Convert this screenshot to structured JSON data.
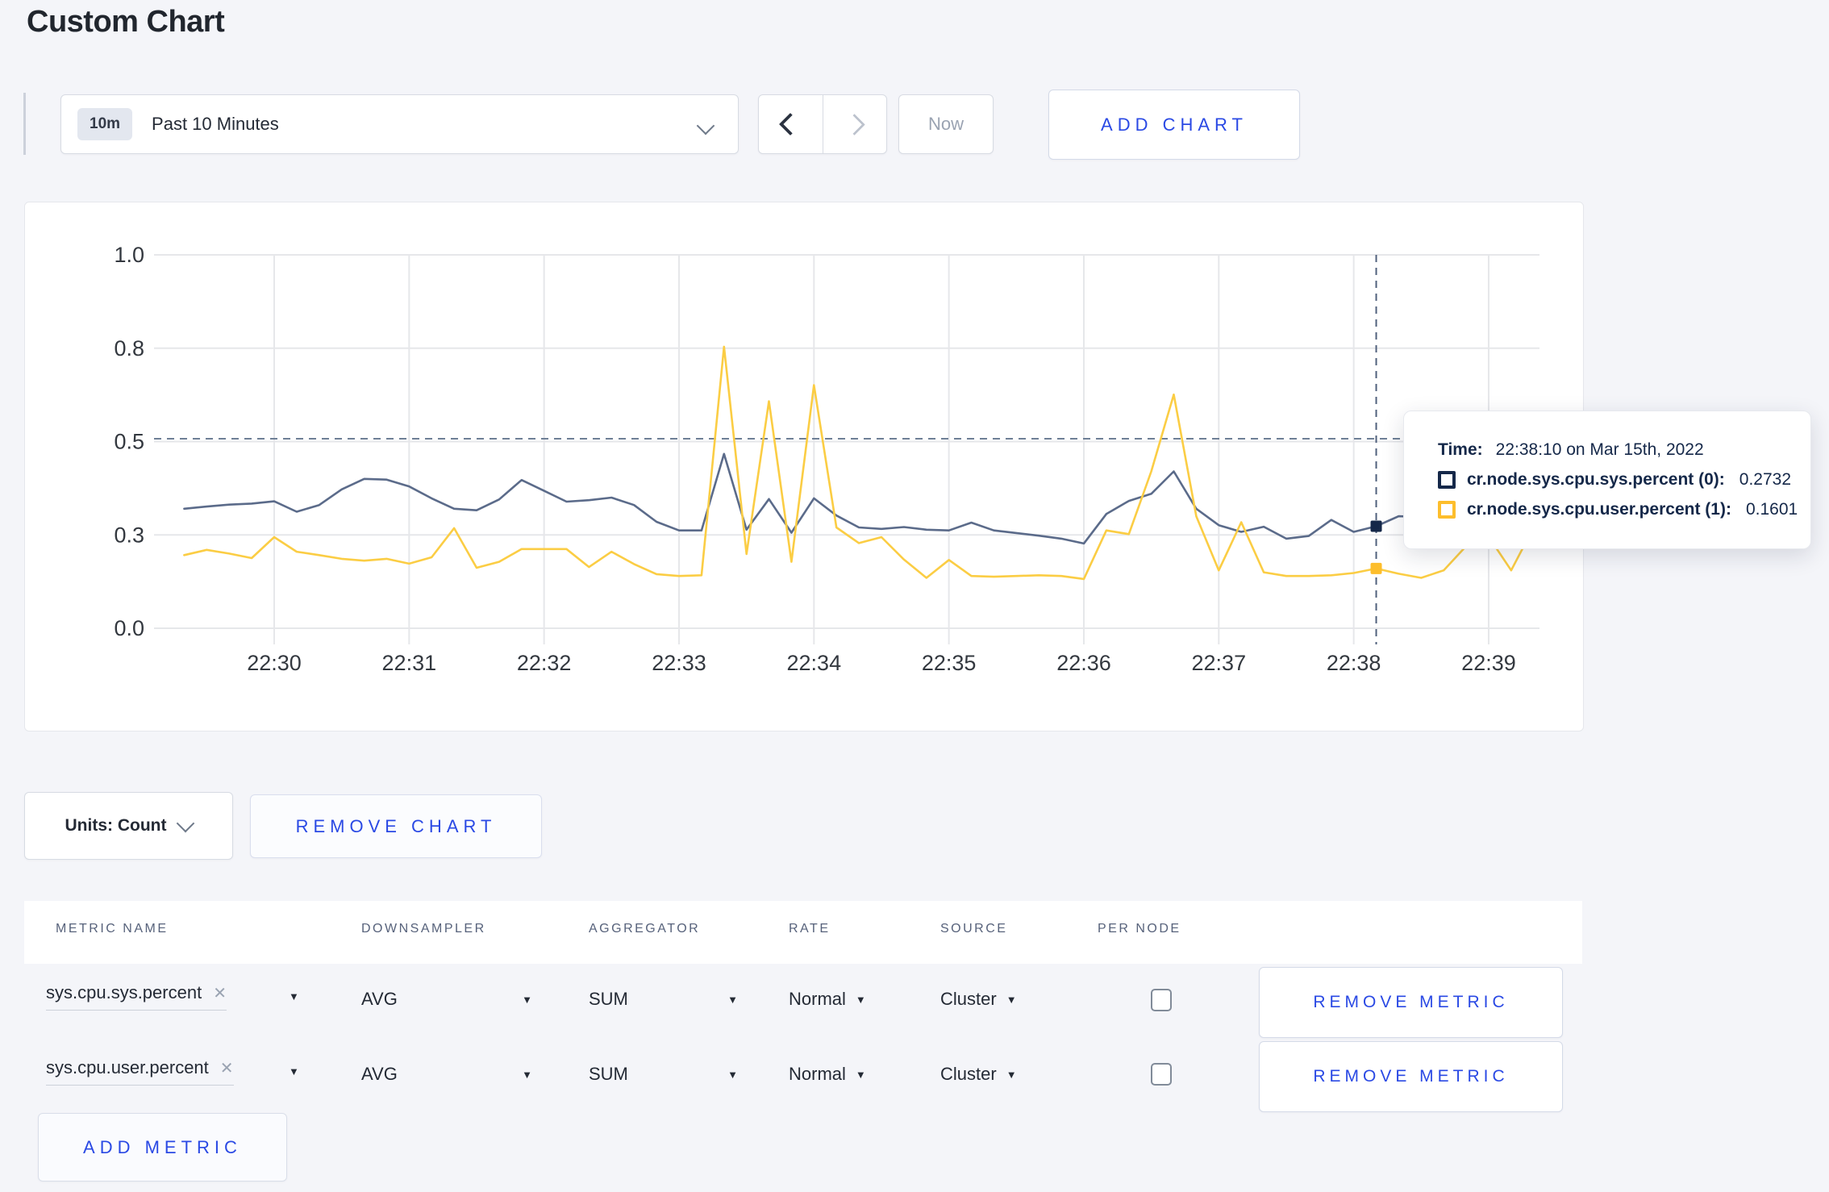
{
  "page": {
    "title": "Custom Chart"
  },
  "toolbar": {
    "time_badge": "10m",
    "time_label": "Past 10 Minutes",
    "now_label": "Now",
    "add_chart_label": "ADD CHART"
  },
  "chart_controls": {
    "units_label": "Units: Count",
    "remove_chart_label": "REMOVE CHART"
  },
  "tooltip": {
    "time_label": "Time:",
    "time_value": "22:38:10 on Mar 15th, 2022",
    "rows": [
      {
        "name": "cr.node.sys.cpu.sys.percent (0):",
        "value": "0.2732",
        "color": "#152849"
      },
      {
        "name": "cr.node.sys.cpu.user.percent (1):",
        "value": "0.1601",
        "color": "#fdbe2c"
      }
    ]
  },
  "chart_data": {
    "type": "line",
    "title": "",
    "xlabel": "",
    "ylabel": "",
    "grid": true,
    "legend_position": "tooltip-only",
    "ylim": [
      0,
      1
    ],
    "x_ticks": [
      "22:30",
      "22:31",
      "22:32",
      "22:33",
      "22:34",
      "22:35",
      "22:36",
      "22:37",
      "22:38",
      "22:39"
    ],
    "y_ticks": [
      {
        "value": 0,
        "label": "0.0"
      },
      {
        "value": 0.25,
        "label": "0.3"
      },
      {
        "value": 0.5,
        "label": "0.5"
      },
      {
        "value": 0.75,
        "label": "0.8"
      },
      {
        "value": 1,
        "label": "1.0"
      }
    ],
    "sample_interval_seconds": 10,
    "series": [
      {
        "name": "cr.node.sys.cpu.sys.percent (0)",
        "color": "#5b6b8a",
        "start_time": "22:29:20",
        "values": [
          0.32,
          0.326,
          0.331,
          0.334,
          0.34,
          0.312,
          0.33,
          0.372,
          0.4,
          0.398,
          0.38,
          0.348,
          0.32,
          0.316,
          0.345,
          0.397,
          0.368,
          0.339,
          0.343,
          0.35,
          0.33,
          0.285,
          0.262,
          0.262,
          0.467,
          0.264,
          0.346,
          0.256,
          0.348,
          0.302,
          0.27,
          0.266,
          0.271,
          0.264,
          0.262,
          0.283,
          0.262,
          0.255,
          0.248,
          0.24,
          0.227,
          0.306,
          0.341,
          0.36,
          0.42,
          0.32,
          0.276,
          0.258,
          0.272,
          0.24,
          0.247,
          0.29,
          0.258,
          0.2732,
          0.3,
          0.298,
          0.302,
          0.295,
          0.3,
          0.298,
          0.3
        ]
      },
      {
        "name": "cr.node.sys.cpu.user.percent (1)",
        "color": "#fbcd44",
        "start_time": "22:29:20",
        "values": [
          0.196,
          0.21,
          0.2,
          0.188,
          0.244,
          0.205,
          0.196,
          0.186,
          0.181,
          0.186,
          0.173,
          0.19,
          0.268,
          0.162,
          0.178,
          0.212,
          0.212,
          0.212,
          0.164,
          0.205,
          0.172,
          0.145,
          0.14,
          0.142,
          0.754,
          0.199,
          0.608,
          0.178,
          0.651,
          0.27,
          0.228,
          0.244,
          0.184,
          0.135,
          0.183,
          0.14,
          0.138,
          0.14,
          0.142,
          0.14,
          0.132,
          0.262,
          0.252,
          0.42,
          0.626,
          0.3,
          0.155,
          0.284,
          0.15,
          0.14,
          0.14,
          0.142,
          0.148,
          0.1601,
          0.146,
          0.135,
          0.155,
          0.22,
          0.245,
          0.155,
          0.27
        ]
      }
    ],
    "hover": {
      "time": "22:38:10",
      "crosshair_value": 0.5075,
      "point_values": {
        "sys": 0.2732,
        "user": 0.1601
      },
      "marker_colors": {
        "sys": "#152849",
        "user": "#fdbe2c"
      }
    }
  },
  "metrics_table": {
    "headers": [
      "METRIC NAME",
      "DOWNSAMPLER",
      "AGGREGATOR",
      "RATE",
      "SOURCE",
      "PER NODE"
    ],
    "rows": [
      {
        "name": "sys.cpu.sys.percent",
        "downsampler": "AVG",
        "aggregator": "SUM",
        "rate": "Normal",
        "source": "Cluster",
        "per_node_checked": false,
        "remove_label": "REMOVE METRIC"
      },
      {
        "name": "sys.cpu.user.percent",
        "downsampler": "AVG",
        "aggregator": "SUM",
        "rate": "Normal",
        "source": "Cluster",
        "per_node_checked": false,
        "remove_label": "REMOVE METRIC"
      }
    ],
    "add_metric_label": "ADD METRIC"
  }
}
